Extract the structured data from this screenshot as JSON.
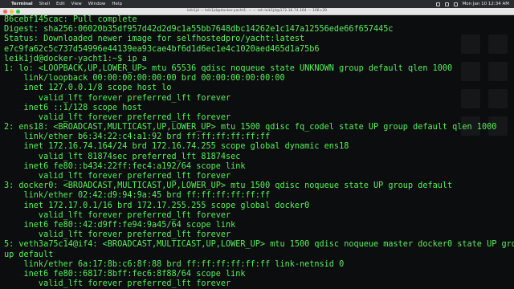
{
  "menubar": {
    "apple": "",
    "app_name": "Terminal",
    "items": [
      "Shell",
      "Edit",
      "View",
      "Window",
      "Help"
    ],
    "clock": "Mon Jan 10  12:34 AM"
  },
  "window": {
    "title": "leik1jd — leik1jd@docker-yacht1: ~ — ssh leik1jd@172.16.74.164 — 106×29"
  },
  "terminal": {
    "lines": [
      "86cebf145cac: Pull complete",
      "Digest: sha256:06020b35df957d42d2d9c1a55bb7648dbc14262e1c147a12556ede66f657445c",
      "Status: Downloaded newer image for selfhostedpro/yacht:latest",
      "e7c9fa62c5c737d54996e44139ea93cae4bf6d1d6ec1e4c1020aed465d1a75b6",
      "leik1jd@docker-yacht1:~$ ip a",
      "1: lo: <LOOPBACK,UP,LOWER_UP> mtu 65536 qdisc noqueue state UNKNOWN group default qlen 1000",
      "    link/loopback 00:00:00:00:00:00 brd 00:00:00:00:00:00",
      "    inet 127.0.0.1/8 scope host lo",
      "       valid_lft forever preferred_lft forever",
      "    inet6 ::1/128 scope host",
      "       valid_lft forever preferred_lft forever",
      "2: ens18: <BROADCAST,MULTICAST,UP,LOWER_UP> mtu 1500 qdisc fq_codel state UP group default qlen 1000",
      "    link/ether b6:34:22:c4:a1:92 brd ff:ff:ff:ff:ff:ff",
      "    inet 172.16.74.164/24 brd 172.16.74.255 scope global dynamic ens18",
      "       valid_lft 81874sec preferred_lft 81874sec",
      "    inet6 fe80::b434:22ff:fec4:a192/64 scope link",
      "       valid_lft forever preferred_lft forever",
      "3: docker0: <BROADCAST,MULTICAST,UP,LOWER_UP> mtu 1500 qdisc noqueue state UP group default",
      "    link/ether 02:42:d9:94:9a:45 brd ff:ff:ff:ff:ff:ff",
      "    inet 172.17.0.1/16 brd 172.17.255.255 scope global docker0",
      "       valid_lft forever preferred_lft forever",
      "    inet6 fe80::42:d9ff:fe94:9a45/64 scope link",
      "       valid_lft forever preferred_lft forever",
      "5: veth3a75c14@if4: <BROADCAST,MULTICAST,UP,LOWER_UP> mtu 1500 qdisc noqueue master docker0 state UP gro",
      "up default",
      "    link/ether 6a:17:8b:c6:8f:88 brd ff:ff:ff:ff:ff:ff link-netnsid 0",
      "    inet6 fe80::6817:8bff:fec6:8f88/64 scope link",
      "       valid_lft forever preferred_lft forever",
      "leik1jd@docker-yacht1:~$ "
    ]
  },
  "colors": {
    "terminal_background": "#0b0d0e",
    "terminal_text": "#58f05b"
  }
}
